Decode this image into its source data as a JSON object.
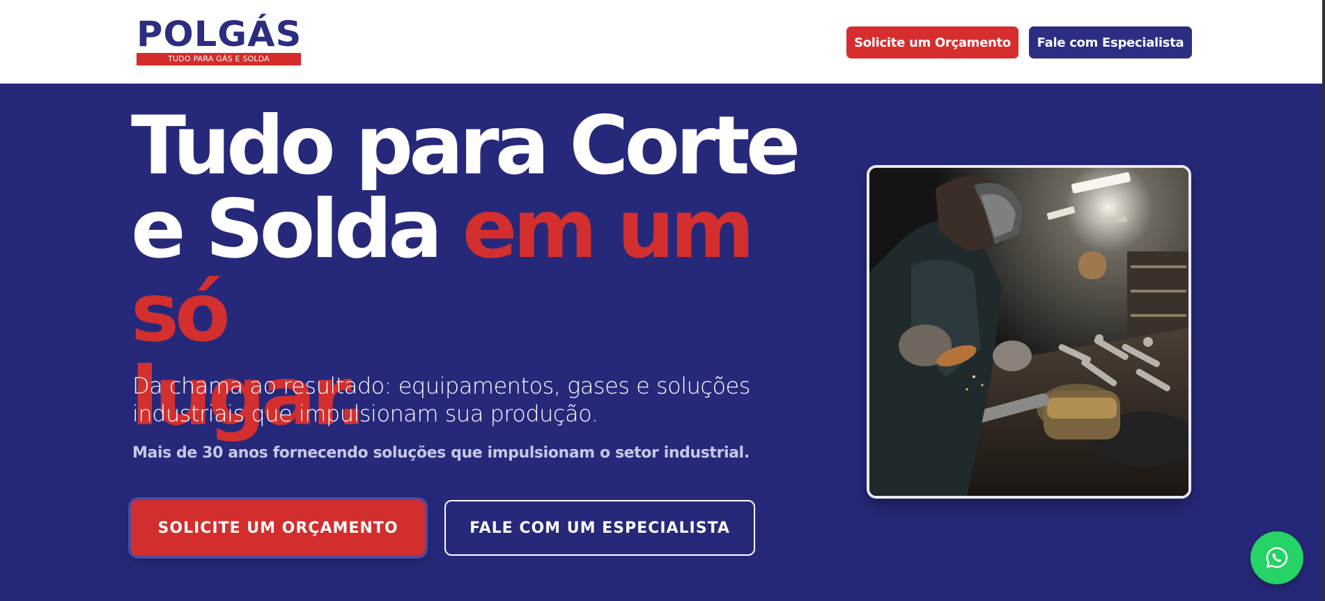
{
  "header": {
    "logo": {
      "wordmark": "POLGÁS",
      "tagline": "TUDO PARA GÁS E SOLDA"
    },
    "buttons": {
      "quote": "Solicite um Orçamento",
      "specialist": "Fale com Especialista"
    }
  },
  "hero": {
    "headline": {
      "line1": "Tudo para Corte",
      "line2_white": "e Solda ",
      "line2_red": "em um só",
      "line3_red": "lugar."
    },
    "subtitle": "Da chama ao resultado: equipamentos, gases e soluções industriais que impulsionam sua produção.",
    "tagline": "Mais de 30 anos fornecendo soluções que impulsionam o setor industrial.",
    "cta": {
      "quote": "SOLICITE UM ORÇAMENTO",
      "specialist": "FALE COM UM ESPECIALISTA"
    },
    "image": {
      "subject": "welder-grinding-metal-workshop-photo"
    }
  },
  "floating": {
    "whatsapp_icon": "whatsapp-icon"
  },
  "colors": {
    "brand_blue": "#26297a",
    "brand_red": "#d32f2f",
    "whatsapp_green": "#25d366",
    "white": "#ffffff"
  }
}
